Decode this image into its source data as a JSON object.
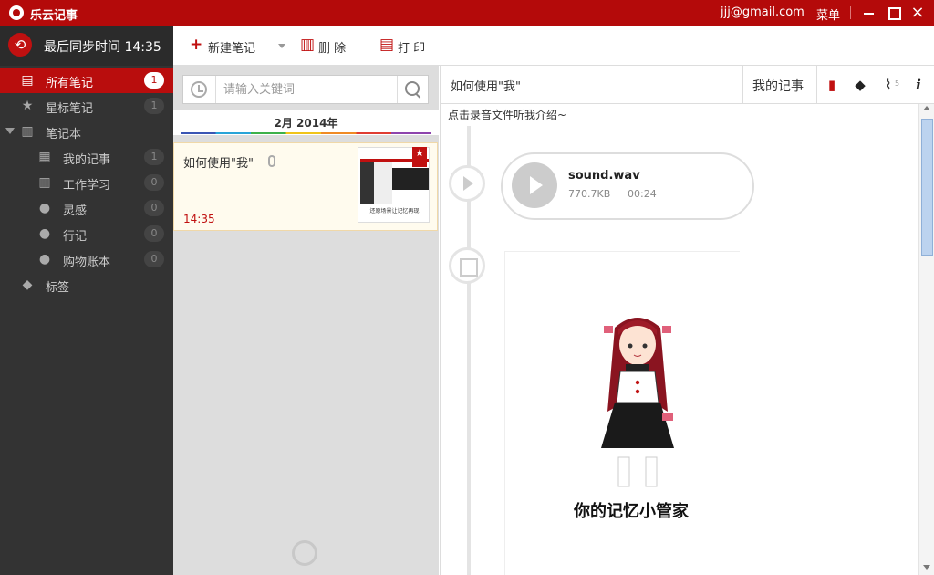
{
  "window": {
    "app_title": "乐云记事",
    "user_email": "jjj@gmail.com",
    "menu_label": "菜单",
    "close_glyph": "×"
  },
  "sidebar": {
    "sync_text": "最后同步时间 14:35",
    "sync_icon_glyph": "⟲",
    "items": [
      {
        "label": "所有笔记",
        "count": "1",
        "icon": "notes-icon",
        "glyph": "▤"
      },
      {
        "label": "星标笔记",
        "count": "1",
        "icon": "star-bookmark-icon",
        "glyph": "★"
      },
      {
        "label": "笔记本",
        "icon": "notebook-icon",
        "glyph": "▥"
      },
      {
        "label": "我的记事",
        "count": "1",
        "icon": "book-open-icon",
        "glyph": "▦"
      },
      {
        "label": "工作学习",
        "count": "0",
        "icon": "books-icon",
        "glyph": "▥"
      },
      {
        "label": "灵感",
        "count": "0",
        "icon": "lightbulb-icon",
        "glyph": "●"
      },
      {
        "label": "行记",
        "count": "0",
        "icon": "speech-bubble-icon",
        "glyph": "●"
      },
      {
        "label": "购物账本",
        "count": "0",
        "icon": "piggy-bank-icon",
        "glyph": "●"
      },
      {
        "label": "标签",
        "icon": "tag-icon",
        "glyph": "◆"
      }
    ]
  },
  "toolbar": {
    "new_note": "新建笔记",
    "delete": "删 除",
    "print": "打 印",
    "new_glyph": "+",
    "delete_glyph": "▥",
    "print_glyph": "▤"
  },
  "notelist": {
    "search_placeholder": "请输入关键词",
    "date_header": "2月  2014年",
    "notes": [
      {
        "title": "如何使用\"我\"",
        "time": "14:35",
        "thumb_caption": "还原场景让记忆再现",
        "starred": true
      }
    ]
  },
  "detail": {
    "title": "如何使用\"我\"",
    "notebook": "我的记事",
    "attachment_count": "5",
    "book_glyph": "▮",
    "tag_glyph": "◆",
    "attach_glyph": "⌇",
    "info_glyph": "i",
    "description": "点击录音文件听我介绍~",
    "audio": {
      "filename": "sound.wav",
      "size": "770.7KB",
      "duration": "00:24"
    },
    "image_caption": "你的记忆小管家"
  },
  "colors": {
    "brand": "#b40a0a",
    "sidebar_bg": "#333333",
    "note_bg": "#fffbee",
    "accent_time": "#c01010"
  }
}
